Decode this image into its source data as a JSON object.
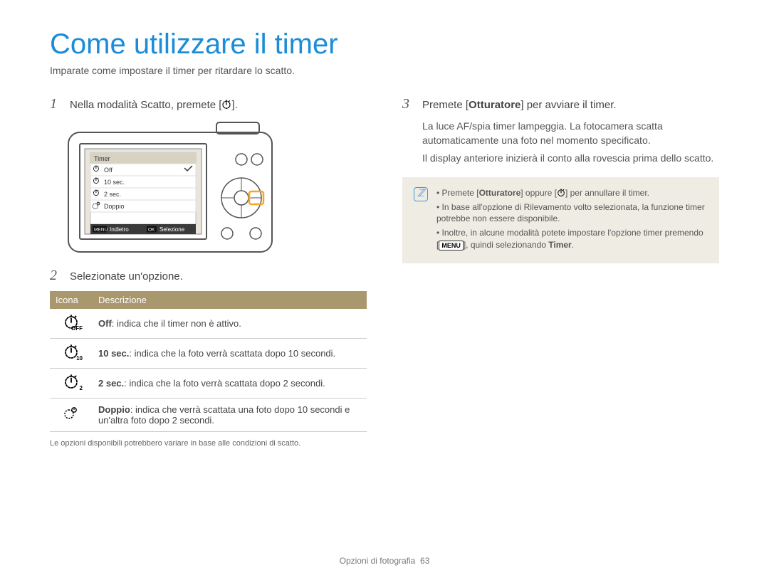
{
  "title": "Come utilizzare il timer",
  "subtitle": "Imparate come impostare il timer per ritardare lo scatto.",
  "steps": {
    "s1": {
      "num": "1",
      "text_before": "Nella modalità Scatto, premete [",
      "text_after": "]."
    },
    "s2": {
      "num": "2",
      "text": "Selezionate un'opzione."
    },
    "s3": {
      "num": "3",
      "text_before": "Premete [",
      "bold": "Otturatore",
      "text_after": "] per avviare il timer."
    }
  },
  "camera_menu": {
    "title": "Timer",
    "items": [
      "Off",
      "10 sec.",
      "2 sec.",
      "Doppio"
    ],
    "back_key": "MENU",
    "back_label": "Indietro",
    "sel_key": "OK",
    "sel_label": "Selezione"
  },
  "table": {
    "headers": {
      "icon": "Icona",
      "desc": "Descrizione"
    },
    "rows": [
      {
        "icon_sub": "OFF",
        "bold": "Off",
        "text": ": indica che il timer non è attivo."
      },
      {
        "icon_sub": "10",
        "bold": "10 sec.",
        "text": ": indica che la foto verrà scattata dopo 10 secondi."
      },
      {
        "icon_sub": "2",
        "bold": "2 sec.",
        "text": ": indica che la foto verrà scattata dopo 2 secondi."
      },
      {
        "icon_sub": "doppio",
        "bold": "Doppio",
        "text": ": indica che verrà scattata una foto dopo 10 secondi e un'altra foto dopo 2 secondi."
      }
    ]
  },
  "footnote": "Le opzioni disponibili potrebbero variare in base alle condizioni di scatto.",
  "para1": "La luce AF/spia timer lampeggia. La fotocamera scatta automaticamente una foto nel momento specificato.",
  "para2": "Il display anteriore inizierà il conto alla rovescia prima dello scatto.",
  "infobox": {
    "li1_a": "Premete [",
    "li1_b": "Otturatore",
    "li1_c": "] oppure [",
    "li1_d": "] per annullare il timer.",
    "li2": "In base all'opzione di Rilevamento volto selezionata, la funzione timer potrebbe non essere disponibile.",
    "li3_a": "Inoltre, in alcune modalità potete impostare l'opzione timer premendo [",
    "li3_key": "MENU",
    "li3_b": "], quindi selezionando ",
    "li3_bold": "Timer",
    "li3_c": "."
  },
  "footer": {
    "section": "Opzioni di fotografia",
    "page": "63"
  }
}
